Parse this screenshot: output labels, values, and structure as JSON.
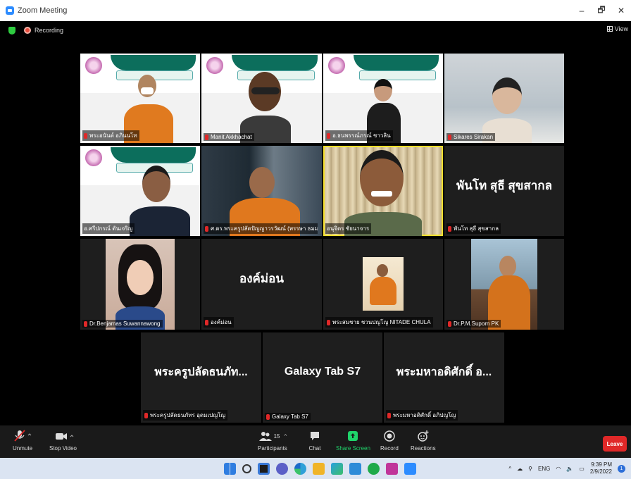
{
  "window": {
    "title": "Zoom Meeting",
    "minimize": "–",
    "restore": "🗗",
    "close": "✕"
  },
  "status": {
    "recording_label": "Recording",
    "view_label": "View"
  },
  "participants_tiles": [
    {
      "name": "พระอนันต์ อภินนโท",
      "banner_caption": "การสนทนากลุ่มเฉพาะ\n(Focus Group Discussion)"
    },
    {
      "name": "Manit Akkhachat",
      "banner_caption": "การสนทนากลุ่มเฉพาะ\n(Focus Group Discussion)"
    },
    {
      "name": "อ.ธนพรรณ์ภรณ์ ชาวลิน",
      "banner_caption": "การสนทนากลุ่มเฉพาะ\n(Focus Group Discussion)"
    },
    {
      "name": "Sikares Sirakan"
    },
    {
      "name": "อ.ศรีปกรณ์ ตันเจริญ",
      "banner_caption": "การสนทนากลุ่มเฉพาะ\n(Focus Group Discussion)"
    },
    {
      "name": "ศ.ดร.พระครูปลัดปัญญาวรวัฒน์ (พรรษา ธมมปาโล)"
    },
    {
      "name": "อนุจิตร ชัยนาจาร"
    },
    {
      "name": "พันโท สุธี สุขสากล",
      "display_text": "พันโท สุธี สุขสากล"
    },
    {
      "name": "Dr.Benjamas Suwannawong"
    },
    {
      "name": "องค์ม่อน",
      "display_text": "องค์ม่อน"
    },
    {
      "name": "พระสมชาย ชวนปญโญ NITADE CHULA"
    },
    {
      "name": "Dr.P.M.Suporn PK"
    },
    {
      "name": "พระครูปลัดธนภัทร อุดมเปญโญ",
      "display_text": "พระครูปลัดธนภัท..."
    },
    {
      "name": "Galaxy Tab S7",
      "display_text": "Galaxy Tab S7"
    },
    {
      "name": "พระมหาอดิศักดิ์ อภิปญโญ",
      "display_text": "พระมหาอดิศักดิ์ อ..."
    }
  ],
  "toolbar": {
    "unmute": "Unmute",
    "stop_video": "Stop Video",
    "participants": "Participants",
    "participant_count": "15",
    "chat": "Chat",
    "share_screen": "Share Screen",
    "record": "Record",
    "reactions": "Reactions",
    "leave": "Leave"
  },
  "taskbar": {
    "language": "ENG",
    "time": "9:39 PM",
    "date": "2/9/2022",
    "notification_count": "1"
  }
}
